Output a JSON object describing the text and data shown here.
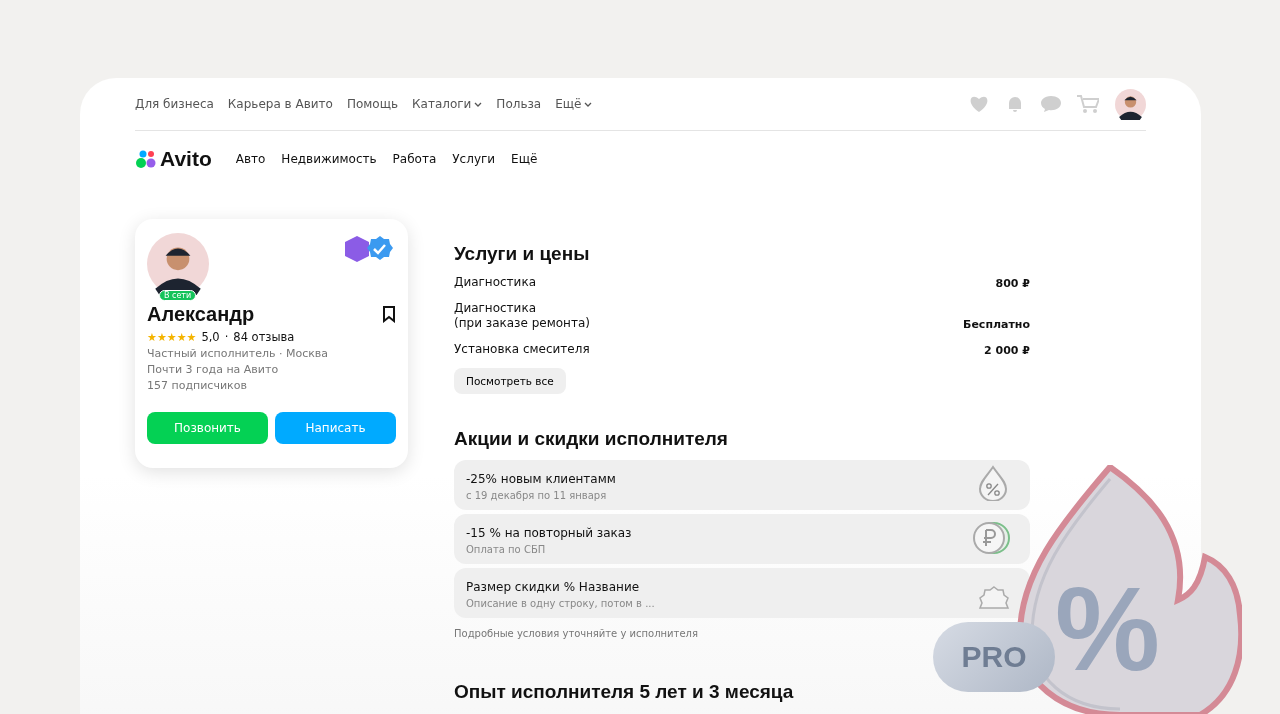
{
  "top_links": [
    {
      "label": "Для бизнеса",
      "caret": false
    },
    {
      "label": "Карьера в Авито",
      "caret": false
    },
    {
      "label": "Помощь",
      "caret": false
    },
    {
      "label": "Каталоги",
      "caret": true
    },
    {
      "label": "Польза",
      "caret": false
    },
    {
      "label": "Ещё",
      "caret": true
    }
  ],
  "logo": "Avito",
  "categories": [
    "Авто",
    "Недвижимость",
    "Работа",
    "Услуги",
    "Ещё"
  ],
  "profile": {
    "separator": "·",
    "status": "В сети",
    "name": "Александр",
    "stars": 5,
    "rating": "5,0",
    "reviews": "84 отзыва",
    "type": "Частный исполнитель",
    "city": "Москва",
    "since": "Почти 3 года на Авито",
    "followers": "157 подписчиков",
    "call": "Позвонить",
    "write": "Написать"
  },
  "services": {
    "title": "Услуги и цены",
    "rows": [
      {
        "name": "Диагностика",
        "price": "800 ₽"
      },
      {
        "name": "Диагностика\n(при заказе ремонта)",
        "price": "Бесплатно"
      },
      {
        "name": "Установка смесителя",
        "price": "2 000 ₽"
      }
    ],
    "more": "Посмотреть все"
  },
  "promos": {
    "title": "Акции и скидки исполнителя",
    "items": [
      {
        "title": "-25% новым клиентамм",
        "subtitle": "с 19 декабря по 11 января",
        "kind": "drop"
      },
      {
        "title": "-15 % на повторный заказ",
        "subtitle": "Оплата по СБП",
        "kind": "coin"
      },
      {
        "title": "Размер скидки % Название",
        "subtitle": "Описание в одну строку, потом в ...",
        "kind": "seal"
      }
    ],
    "note": "Подробные условия уточняйте у исполнителя"
  },
  "experience": {
    "title": "Опыт исполнителя 5 лет и 3 месяца"
  },
  "decor": {
    "badge": "PRO",
    "symbol": "%"
  }
}
